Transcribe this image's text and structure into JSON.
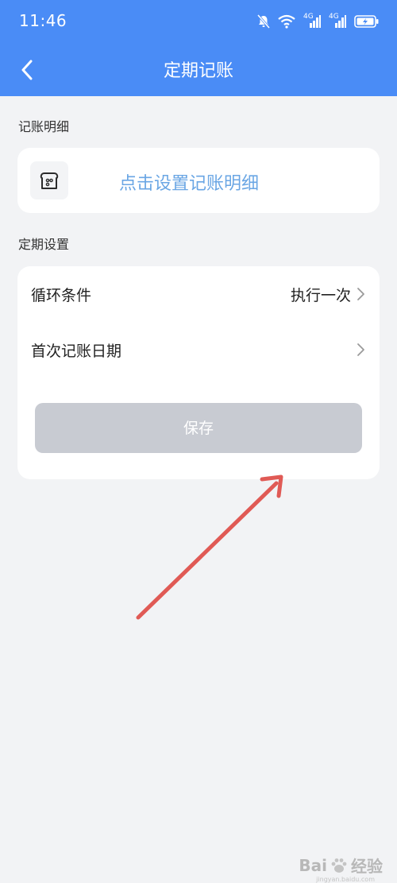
{
  "status_bar": {
    "time": "11:46",
    "network_1": "4G",
    "network_2": "4G"
  },
  "nav": {
    "title": "定期记账"
  },
  "sections": {
    "detail_label": "记账明细",
    "settings_label": "定期设置"
  },
  "detail_card": {
    "link_text": "点击设置记账明细",
    "icon": "bread-icon"
  },
  "settings": {
    "cycle_label": "循环条件",
    "cycle_value": "执行一次",
    "first_date_label": "首次记账日期",
    "first_date_value": ""
  },
  "save_button": {
    "label": "保存"
  },
  "watermark": {
    "brand": "Bai",
    "brand_suffix": "经验",
    "sub": "jingyan.baidu.com"
  },
  "colors": {
    "header_bg": "#4a8cf6",
    "page_bg": "#f2f3f5",
    "link": "#6aa6e4",
    "save_disabled": "#c8cbd2",
    "annotation_arrow": "#e05a55"
  }
}
